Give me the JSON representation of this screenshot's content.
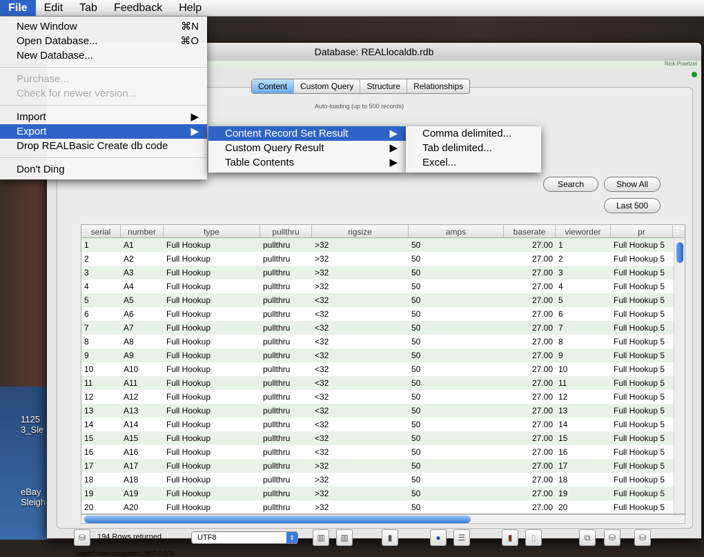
{
  "menubar": [
    "File",
    "Edit",
    "Tab",
    "Feedback",
    "Help"
  ],
  "file_menu": {
    "new_window": "New Window",
    "new_window_sc": "⌘N",
    "open_db": "Open Database...",
    "open_db_sc": "⌘O",
    "new_db": "New Database...",
    "purchase": "Purchase...",
    "check": "Check for newer version...",
    "import": "Import",
    "export": "Export",
    "drop": "Drop REALBasic Create db code",
    "ding": "Don't Ding",
    "arrow": "▶"
  },
  "export_menu": [
    "Content Record Set Result",
    "Custom Query Result",
    "Table Contents"
  ],
  "format_menu": [
    "Comma delimited...",
    "Tab delimited...",
    "Excel..."
  ],
  "window": {
    "title": "Database: REALlocaldb.rdb",
    "user": "Rick Praetzel"
  },
  "tabs": [
    "Content",
    "Custom Query",
    "Structure",
    "Relationships"
  ],
  "auto_loading": "Auto-loading (up to 500 records)",
  "buttons": {
    "search": "Search",
    "show_all": "Show All",
    "last500": "Last 500"
  },
  "table": {
    "columns": [
      "serial",
      "number",
      "type",
      "pullthru",
      "rigsize",
      "amps",
      "baserate",
      "vieworder",
      "pr"
    ],
    "rows": [
      [
        "1",
        "A1",
        "Full Hookup",
        "pullthru",
        ">32",
        "50",
        "27.00",
        "1",
        "Full Hookup 5"
      ],
      [
        "2",
        "A2",
        "Full Hookup",
        "pullthru",
        ">32",
        "50",
        "27.00",
        "2",
        "Full Hookup 5"
      ],
      [
        "3",
        "A3",
        "Full Hookup",
        "pullthru",
        ">32",
        "50",
        "27.00",
        "3",
        "Full Hookup 5"
      ],
      [
        "4",
        "A4",
        "Full Hookup",
        "pullthru",
        ">32",
        "50",
        "27.00",
        "4",
        "Full Hookup 5"
      ],
      [
        "5",
        "A5",
        "Full Hookup",
        "pullthru",
        "<32",
        "50",
        "27.00",
        "5",
        "Full Hookup 5"
      ],
      [
        "6",
        "A6",
        "Full Hookup",
        "pullthru",
        "<32",
        "50",
        "27.00",
        "6",
        "Full Hookup 5"
      ],
      [
        "7",
        "A7",
        "Full Hookup",
        "pullthru",
        "<32",
        "50",
        "27.00",
        "7",
        "Full Hookup 5"
      ],
      [
        "8",
        "A8",
        "Full Hookup",
        "pullthru",
        "<32",
        "50",
        "27.00",
        "8",
        "Full Hookup 5"
      ],
      [
        "9",
        "A9",
        "Full Hookup",
        "pullthru",
        "<32",
        "50",
        "27.00",
        "9",
        "Full Hookup 5"
      ],
      [
        "10",
        "A10",
        "Full Hookup",
        "pullthru",
        "<32",
        "50",
        "27.00",
        "10",
        "Full Hookup 5"
      ],
      [
        "11",
        "A11",
        "Full Hookup",
        "pullthru",
        "<32",
        "50",
        "27.00",
        "11",
        "Full Hookup 5"
      ],
      [
        "12",
        "A12",
        "Full Hookup",
        "pullthru",
        "<32",
        "50",
        "27.00",
        "12",
        "Full Hookup 5"
      ],
      [
        "13",
        "A13",
        "Full Hookup",
        "pullthru",
        "<32",
        "50",
        "27.00",
        "13",
        "Full Hookup 5"
      ],
      [
        "14",
        "A14",
        "Full Hookup",
        "pullthru",
        "<32",
        "50",
        "27.00",
        "14",
        "Full Hookup 5"
      ],
      [
        "15",
        "A15",
        "Full Hookup",
        "pullthru",
        "<32",
        "50",
        "27.00",
        "15",
        "Full Hookup 5"
      ],
      [
        "16",
        "A16",
        "Full Hookup",
        "pullthru",
        "<32",
        "50",
        "27.00",
        "16",
        "Full Hookup 5"
      ],
      [
        "17",
        "A17",
        "Full Hookup",
        "pullthru",
        ">32",
        "50",
        "27.00",
        "17",
        "Full Hookup 5"
      ],
      [
        "18",
        "A18",
        "Full Hookup",
        "pullthru",
        ">32",
        "50",
        "27.00",
        "18",
        "Full Hookup 5"
      ],
      [
        "19",
        "A19",
        "Full Hookup",
        "pullthru",
        ">32",
        "50",
        "27.00",
        "19",
        "Full Hookup 5"
      ],
      [
        "20",
        "A20",
        "Full Hookup",
        "pullthru",
        ">32",
        "50",
        "27.00",
        "20",
        "Full Hookup 5"
      ]
    ]
  },
  "status": {
    "rows_returned": "194 Rows returned",
    "encoding": "UTF8",
    "query": "Select * from campsites LIMIT 0,500"
  },
  "desktop": {
    "icon1": "1125\n3_Sle",
    "icon2": "eBay\nSleigh"
  }
}
